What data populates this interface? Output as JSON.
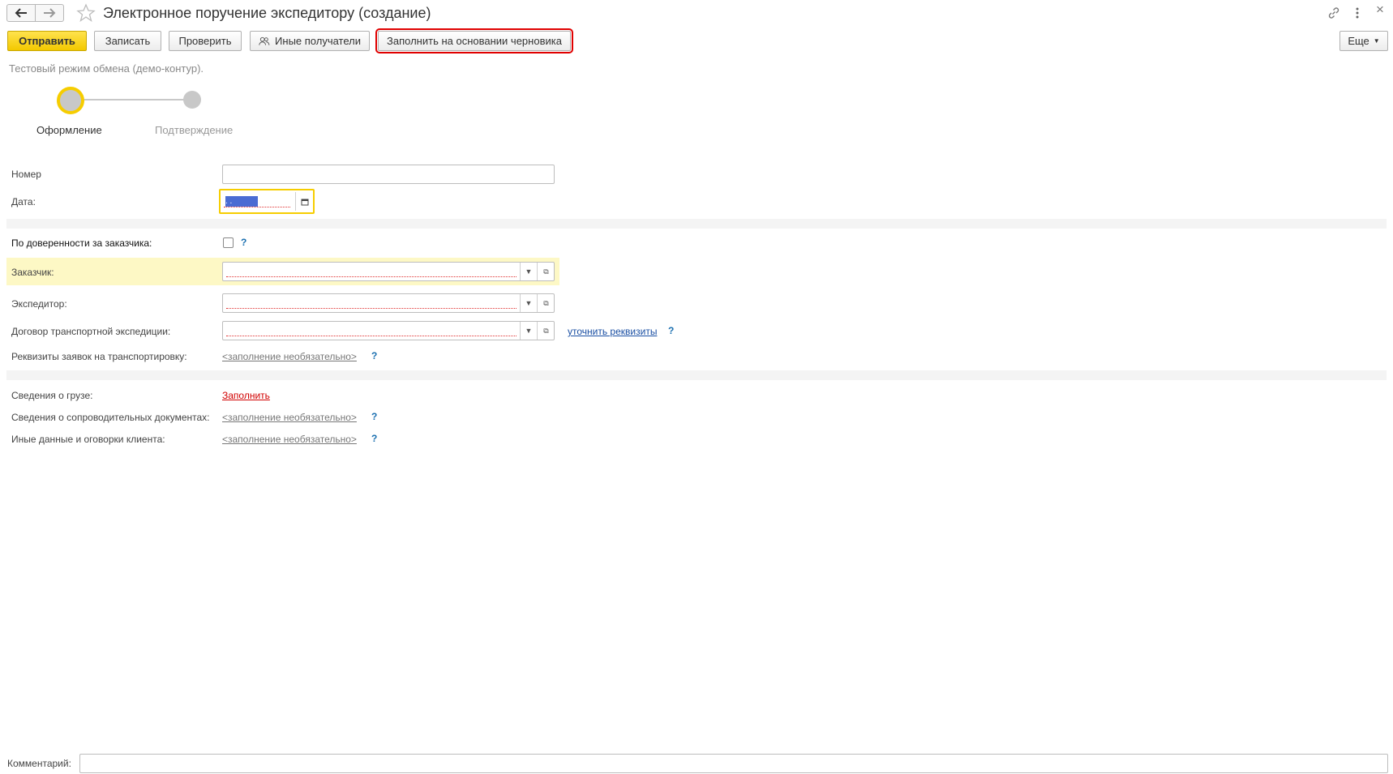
{
  "window": {
    "title": "Электронное поручение экспедитору (создание)"
  },
  "toolbar": {
    "send_label": "Отправить",
    "save_label": "Записать",
    "check_label": "Проверить",
    "other_recipients_label": "Иные получатели",
    "fill_from_draft_label": "Заполнить на основании черновика",
    "more_label": "Еще"
  },
  "mode_text": "Тестовый режим обмена (демо-контур).",
  "steps": [
    {
      "label": "Оформление",
      "active": true
    },
    {
      "label": "Подтверждение",
      "active": false
    }
  ],
  "form": {
    "number_label": "Номер",
    "number_value": "",
    "date_label": "Дата:",
    "date_value": " .  .",
    "by_proxy_label": "По доверенности за заказчика:",
    "by_proxy_checked": false,
    "customer_label": "Заказчик:",
    "customer_value": "",
    "forwarder_label": "Экспедитор:",
    "forwarder_value": "",
    "contract_label": "Договор транспортной экспедиции:",
    "contract_value": "",
    "clarify_link": "уточнить реквизиты",
    "transport_req_label": "Реквизиты заявок на транспортировку:",
    "optional_text": "<заполнение необязательно>",
    "cargo_label": "Сведения о грузе:",
    "cargo_link": "Заполнить",
    "docs_label": "Сведения о сопроводительных документах:",
    "other_data_label": "Иные данные и оговорки клиента:",
    "help_mark": "?"
  },
  "footer": {
    "comment_label": "Комментарий:",
    "comment_value": ""
  },
  "colors": {
    "primary_button": "#f3c800",
    "highlight_outline": "#e00000",
    "active_field_bg": "#fdf8c5",
    "link_blue": "#1a4fa3",
    "link_red": "#d10000"
  }
}
